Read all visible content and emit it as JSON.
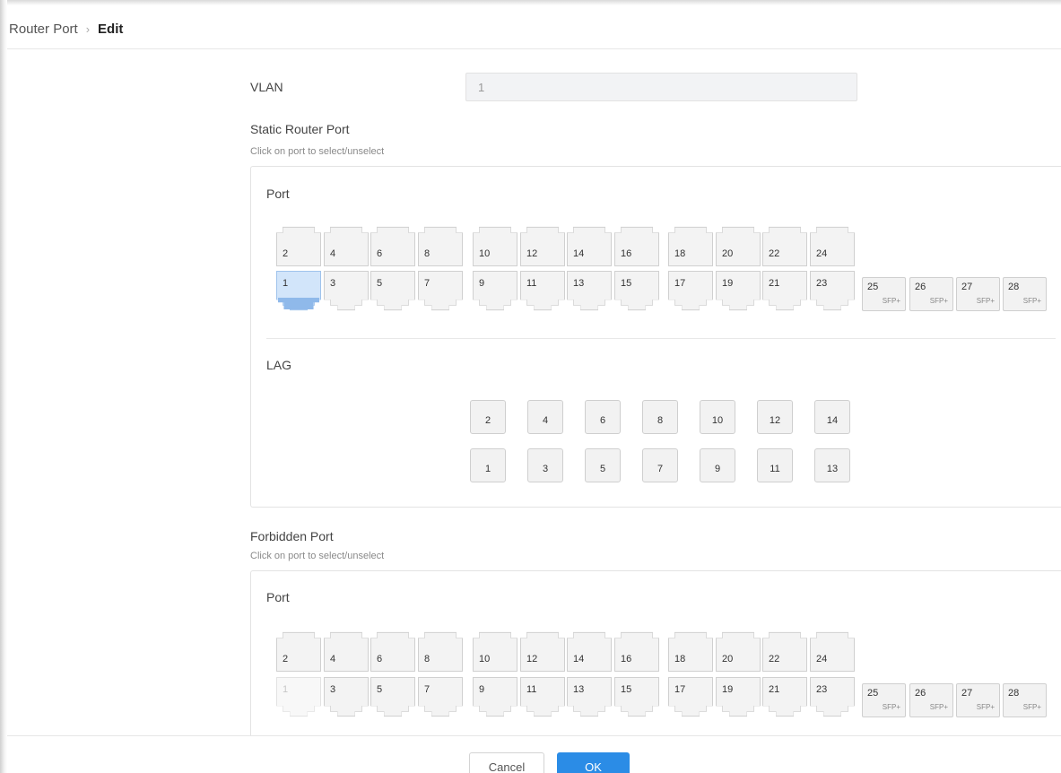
{
  "breadcrumb": {
    "parent": "Router Port",
    "separator": "›",
    "current": "Edit"
  },
  "vlan": {
    "label": "VLAN",
    "value": "1"
  },
  "static_section": {
    "title": "Static Router Port",
    "hint": "Click on port to select/unselect",
    "port_label": "Port",
    "lag_label": "LAG",
    "selected_ports": [
      "1"
    ],
    "disabled_ports": []
  },
  "forbidden_section": {
    "title": "Forbidden Port",
    "hint": "Click on port to select/unselect",
    "port_label": "Port",
    "selected_ports": [],
    "disabled_ports": [
      "1"
    ]
  },
  "ports": {
    "top_groups": [
      [
        "2",
        "4",
        "6",
        "8"
      ],
      [
        "10",
        "12",
        "14",
        "16"
      ],
      [
        "18",
        "20",
        "22",
        "24"
      ]
    ],
    "bottom_groups": [
      [
        "1",
        "3",
        "5",
        "7"
      ],
      [
        "9",
        "11",
        "13",
        "15"
      ],
      [
        "17",
        "19",
        "21",
        "23"
      ]
    ],
    "sfp": [
      {
        "num": "25",
        "type": "SFP+"
      },
      {
        "num": "26",
        "type": "SFP+"
      },
      {
        "num": "27",
        "type": "SFP+"
      },
      {
        "num": "28",
        "type": "SFP+"
      }
    ]
  },
  "lags": {
    "top": [
      "2",
      "4",
      "6",
      "8",
      "10",
      "12",
      "14"
    ],
    "bottom": [
      "1",
      "3",
      "5",
      "7",
      "9",
      "11",
      "13"
    ]
  },
  "footer": {
    "cancel_label": "Cancel",
    "ok_label": "OK"
  },
  "colors": {
    "primary": "#2b8ce6",
    "selected_port": "#8fb9ea"
  }
}
